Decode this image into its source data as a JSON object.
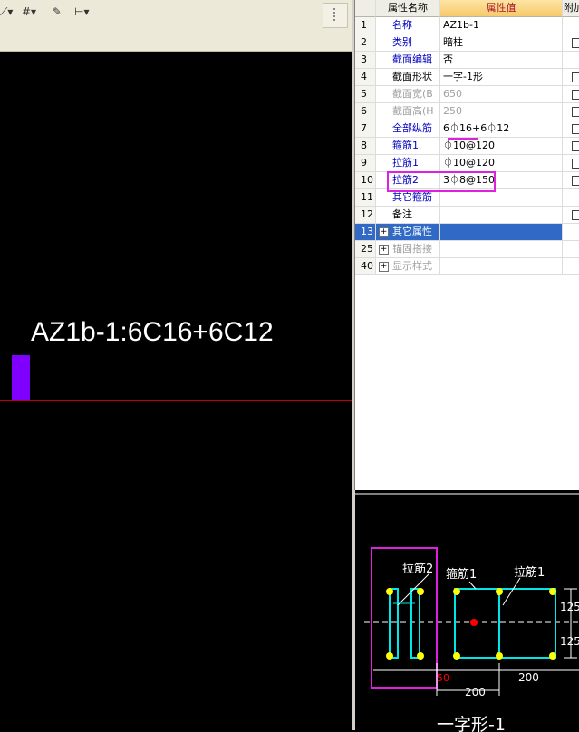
{
  "toolbar": {
    "tools": [
      {
        "name": "line-tool-icon",
        "glyph": "⟋▾"
      },
      {
        "name": "grid-tool-icon",
        "glyph": "#▾"
      },
      {
        "name": "pen-tool-icon",
        "glyph": "✎"
      },
      {
        "name": "dimension-tool-icon",
        "glyph": "⊢▾"
      }
    ]
  },
  "canvas": {
    "label": "AZ1b-1:6C16+6C12",
    "wall_color": "#7f00ff",
    "axis_color": "#c00000"
  },
  "grid": {
    "headers": {
      "name": "属性名称",
      "value": "属性值",
      "extra": "附加"
    },
    "rows": [
      {
        "num": "1",
        "name": "名称",
        "value": "AZ1b-1",
        "style": "blue",
        "check": false
      },
      {
        "num": "2",
        "name": "类别",
        "value": "暗柱",
        "style": "blue",
        "check": true
      },
      {
        "num": "3",
        "name": "截面编辑",
        "value": "否",
        "style": "blue",
        "check": false
      },
      {
        "num": "4",
        "name": "截面形状",
        "value": "一字-1形",
        "style": "black",
        "check": true
      },
      {
        "num": "5",
        "name": "截面宽(B",
        "value": "650",
        "style": "gray",
        "check": true
      },
      {
        "num": "6",
        "name": "截面高(H",
        "value": "250",
        "style": "gray",
        "check": true
      },
      {
        "num": "7",
        "name": "全部纵筋",
        "value": "6⏀16+6⏀12",
        "style": "blue",
        "check": true
      },
      {
        "num": "8",
        "name": "箍筋1",
        "value": "⏀10@120",
        "style": "blue",
        "check": true
      },
      {
        "num": "9",
        "name": "拉筋1",
        "value": "⏀10@120",
        "style": "blue",
        "check": true
      },
      {
        "num": "10",
        "name": "拉筋2",
        "value": "3⏀8@150",
        "style": "blue",
        "check": true
      },
      {
        "num": "11",
        "name": "其它箍筋",
        "value": "",
        "style": "blue",
        "check": false
      },
      {
        "num": "12",
        "name": "备注",
        "value": "",
        "style": "black",
        "check": true
      },
      {
        "num": "13",
        "name": "其它属性",
        "value": "",
        "style": "group-selected",
        "check": false
      },
      {
        "num": "25",
        "name": "锚固搭接",
        "value": "",
        "style": "group",
        "check": false
      },
      {
        "num": "40",
        "name": "显示样式",
        "value": "",
        "style": "group",
        "check": false
      }
    ]
  },
  "preview": {
    "labels": {
      "tie2": "拉筋2",
      "stirrup1": "箍筋1",
      "tie1": "拉筋1",
      "dim_right_top": "125",
      "dim_right_bottom": "125",
      "dim_200_bottom": "200",
      "dim_200_mid": "200",
      "dim_50": "50",
      "shape_name": "一字形-1"
    },
    "colors": {
      "stirrup": "#00e5e5",
      "rebar": "#ffff00",
      "highlight": "#e020e0",
      "dim": "#ffffff",
      "center_rebar": "#ff0000"
    }
  }
}
